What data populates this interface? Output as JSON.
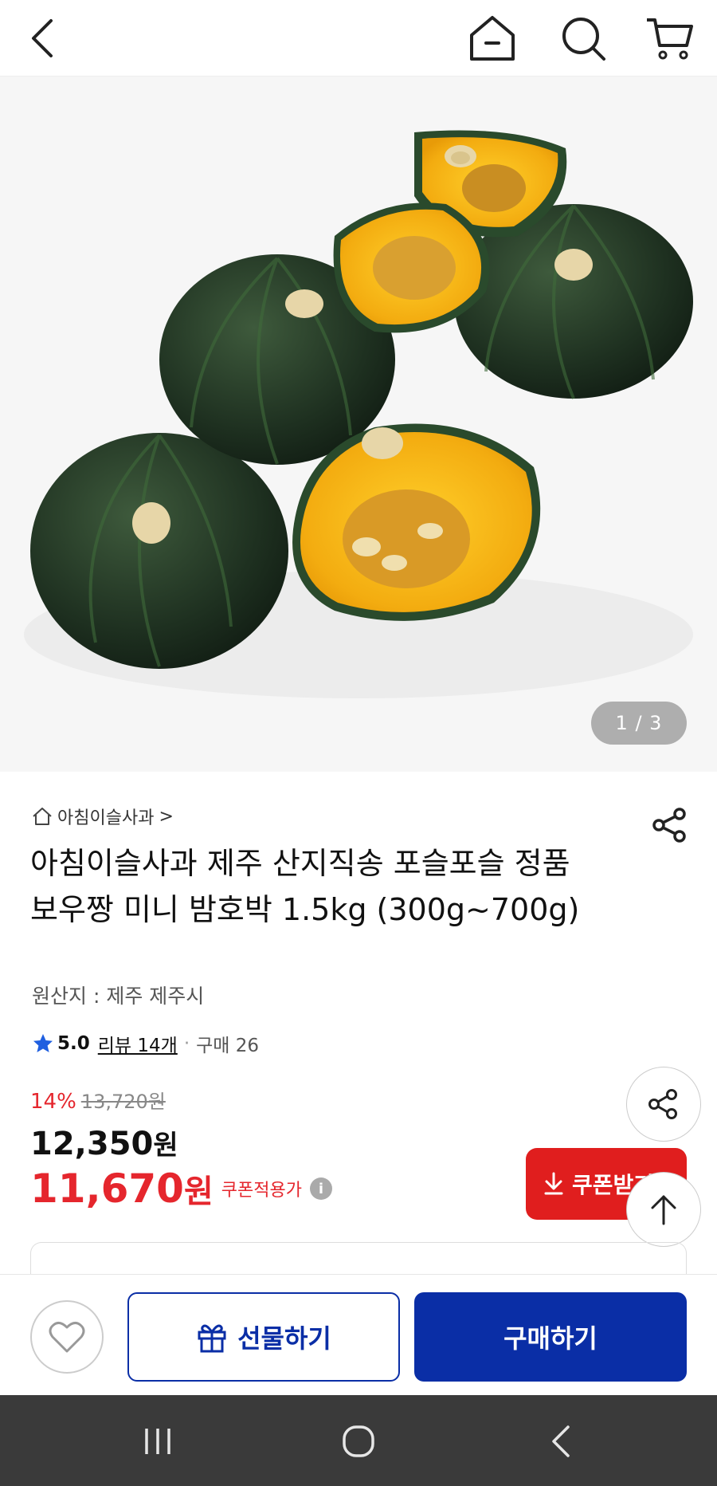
{
  "pager": {
    "current": "1",
    "sep": "/",
    "total": "3",
    "text": "1 / 3"
  },
  "store": {
    "name": "아침이슬사과",
    "chevron": ">"
  },
  "product": {
    "title": "아침이슬사과 제주 산지직송 포슬포슬 정품 보우짱 미니 밤호박 1.5kg (300g~700g)",
    "origin": "원산지 : 제주 제주시"
  },
  "rating": {
    "score": "5.0",
    "review_label": "리뷰 14개",
    "dot": "·",
    "purchase": "구매 26"
  },
  "price": {
    "discount_rate": "14%",
    "original": "13,720원",
    "sale_amount": "12,350",
    "sale_unit": "원",
    "coupon_amount": "11,670",
    "coupon_unit": "원",
    "coupon_label": "쿠폰적용가",
    "info_glyph": "i"
  },
  "buttons": {
    "coupon": "쿠폰받기",
    "gift": "선물하기",
    "buy": "구매하기"
  },
  "colors": {
    "accent_red": "#e5262d",
    "primary_blue": "#0a2ea6",
    "pager_bg": "#969696"
  },
  "icons": [
    "back-icon",
    "home-icon",
    "search-icon",
    "cart-icon",
    "share-icon",
    "star-icon",
    "download-icon",
    "arrow-up-icon",
    "heart-icon",
    "gift-icon",
    "recent-apps-icon",
    "home-circle-icon",
    "nav-back-icon"
  ]
}
